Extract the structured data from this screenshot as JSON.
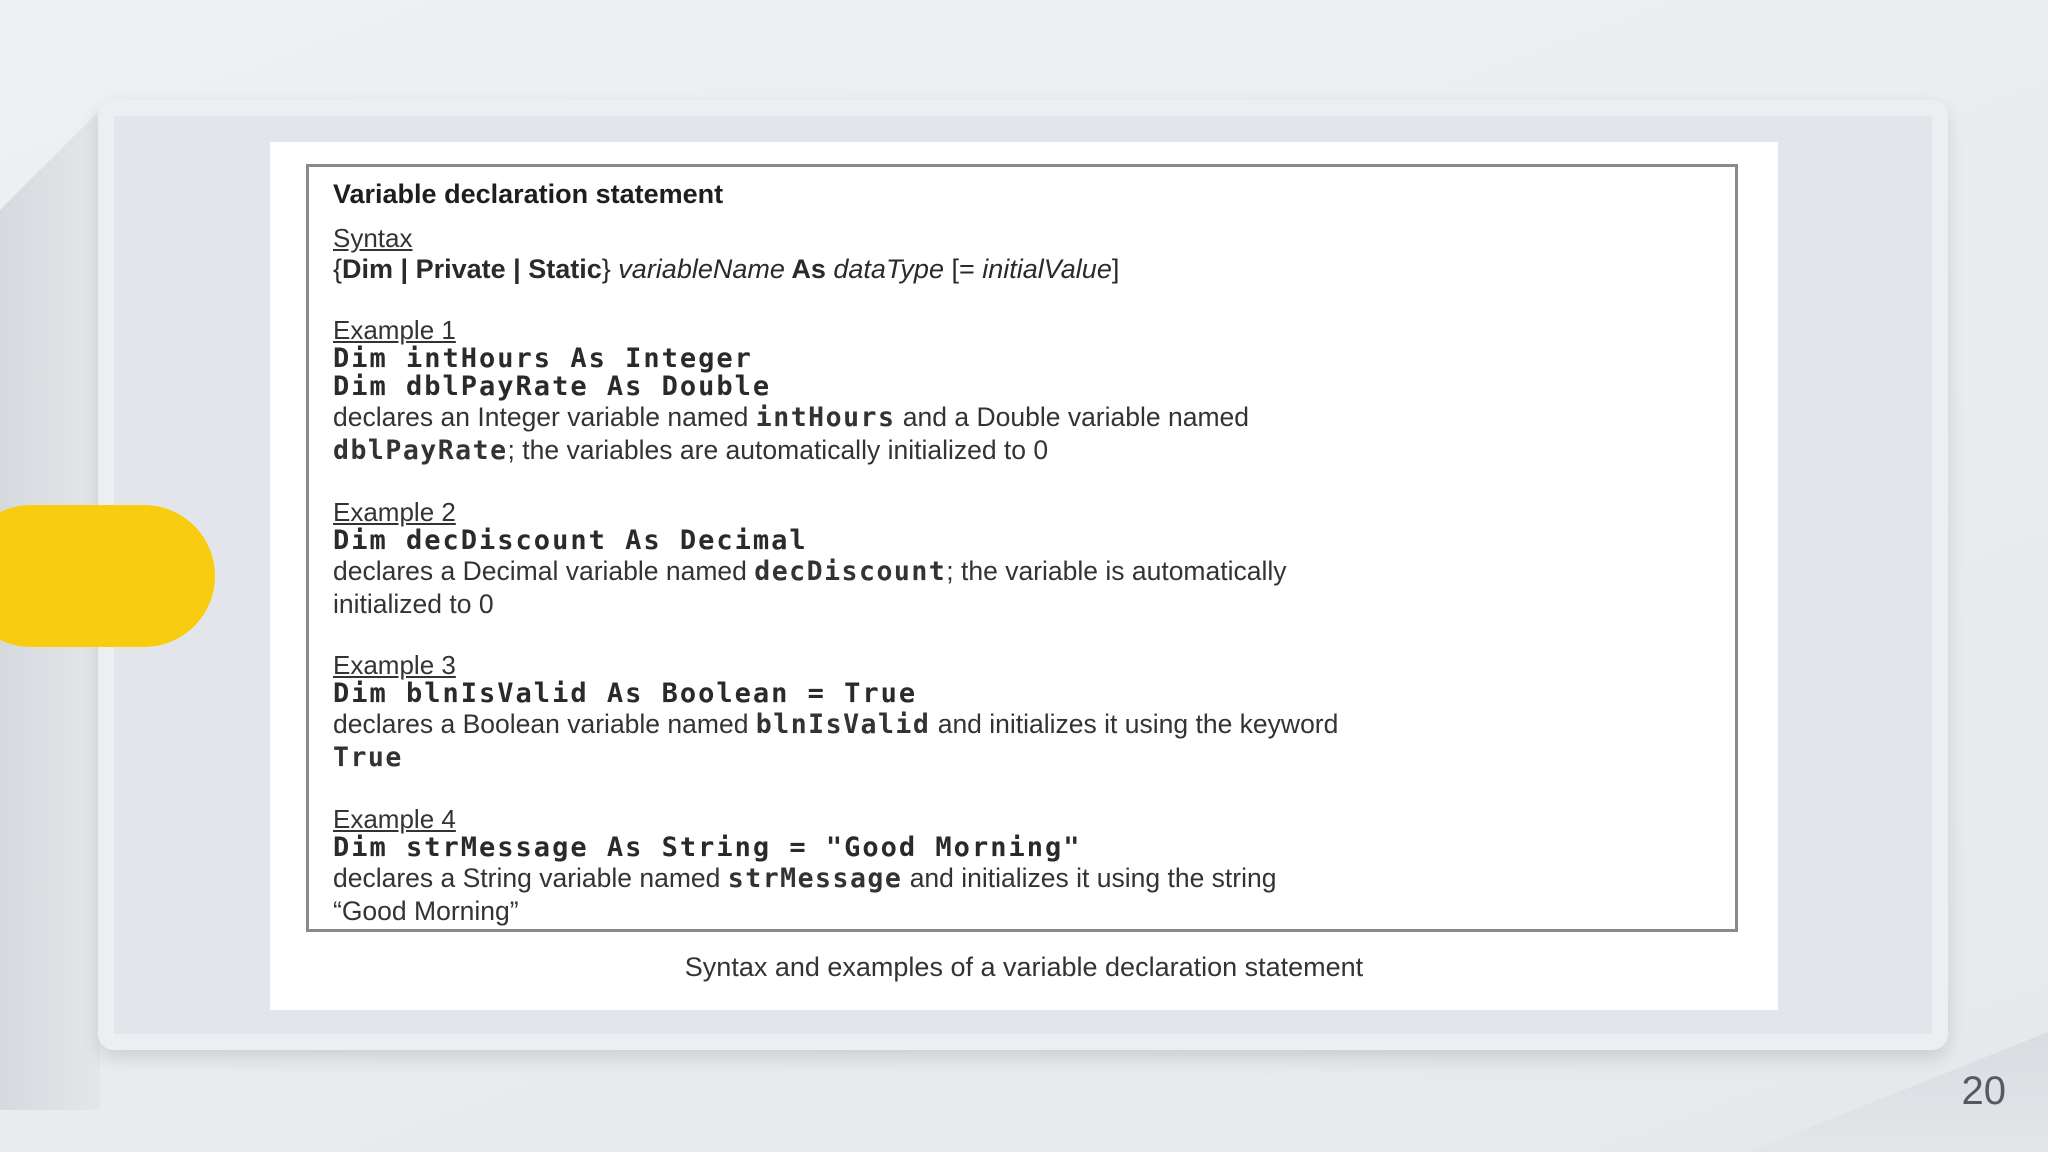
{
  "accent_color": "#F8CC0F",
  "figure": {
    "title": "Variable declaration statement",
    "syntax": {
      "heading": "Syntax",
      "open": "{",
      "dim": "Dim",
      "sep1": " | ",
      "private": "Private",
      "sep2": " | ",
      "static": "Static",
      "close": "} ",
      "var_name": "variableName",
      "as": " As ",
      "data_type": "dataType",
      "init_open": " [= ",
      "init_value": "initialValue",
      "init_close": "]"
    },
    "example1": {
      "heading": "Example 1",
      "code1": "Dim intHours As Integer",
      "code2": "Dim dblPayRate As Double",
      "desc_a": "declares an Integer variable named ",
      "desc_code_a": "intHours",
      "desc_b": " and a Double variable named",
      "desc_code_b": "dblPayRate",
      "desc_c": "; the variables are automatically initialized to 0"
    },
    "example2": {
      "heading": "Example 2",
      "code1": "Dim decDiscount As Decimal",
      "desc_a": "declares a Decimal variable named ",
      "desc_code_a": "decDiscount",
      "desc_b": "; the variable is automatically",
      "desc_c": "initialized to 0"
    },
    "example3": {
      "heading": "Example 3",
      "code1": "Dim blnIsValid As Boolean = True",
      "desc_a": "declares a Boolean variable named ",
      "desc_code_a": "blnIsValid",
      "desc_b": " and initializes it using the keyword",
      "desc_code_b": "True"
    },
    "example4": {
      "heading": "Example 4",
      "code1": "Dim strMessage As String = \"Good Morning\"",
      "desc_a": "declares a String variable named ",
      "desc_code_a": "strMessage",
      "desc_b": " and initializes it using the string",
      "desc_c": "“Good Morning”"
    },
    "caption": "Syntax and examples of a variable declaration statement"
  },
  "page_number": "20"
}
